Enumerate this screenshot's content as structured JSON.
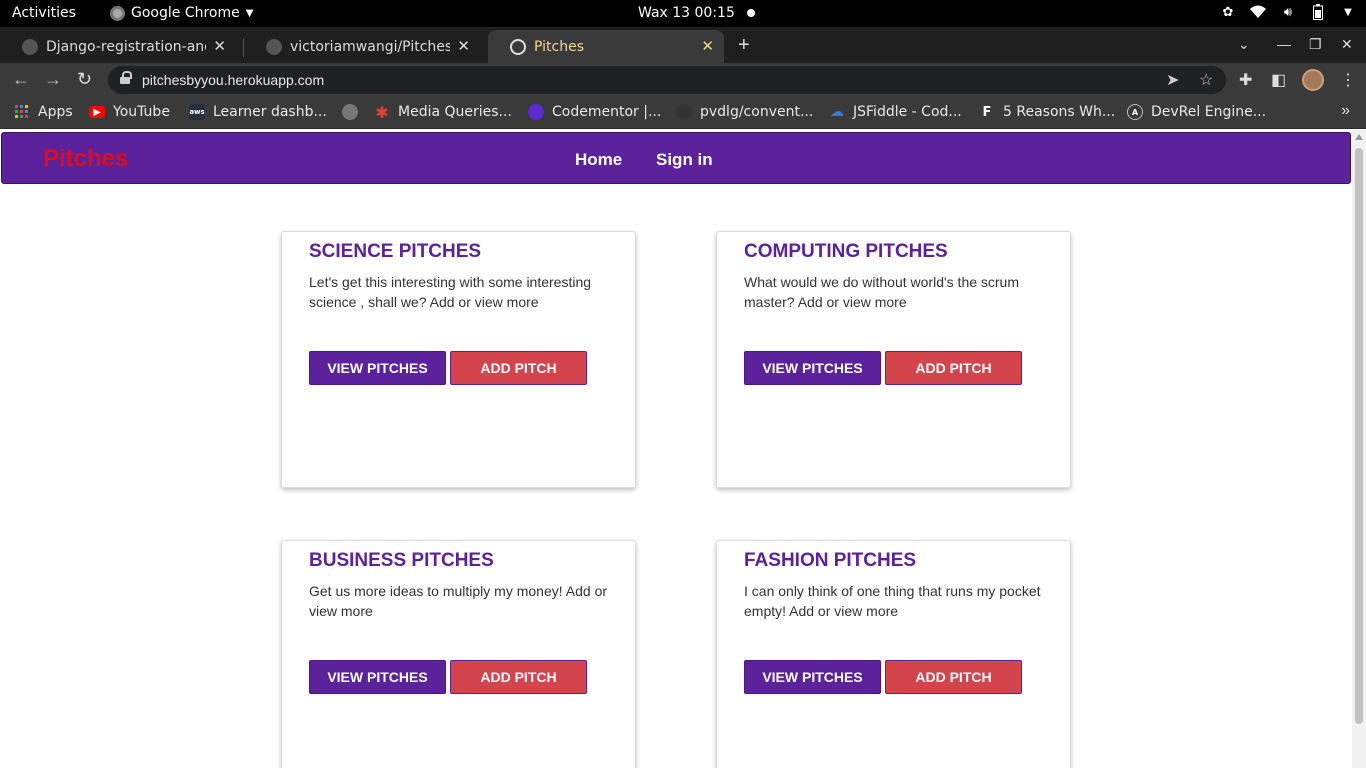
{
  "system_bar": {
    "activities": "Activities",
    "app_name": "Google Chrome",
    "clock": "Wax 13  00:15"
  },
  "tabs": [
    {
      "title": "Django-registration-and-l",
      "active": false
    },
    {
      "title": "victoriamwangi/Pitches: T",
      "active": false
    },
    {
      "title": "Pitches",
      "active": true
    }
  ],
  "address_bar": {
    "url": "pitchesbyyou.herokuapp.com"
  },
  "bookmarks": [
    {
      "label": "Apps",
      "icon": "apps-grid-icon",
      "color": "#e94235"
    },
    {
      "label": "YouTube",
      "icon": "youtube-icon",
      "color": "#ff0000"
    },
    {
      "label": "Learner dashb...",
      "icon": "aws-icon",
      "color": "#232f3e"
    },
    {
      "label": "",
      "icon": "globe-icon",
      "color": "#777777"
    },
    {
      "label": "Media Queries...",
      "icon": "asterisk-icon",
      "color": "#e94235"
    },
    {
      "label": "Codementor |...",
      "icon": "codementor-icon",
      "color": "#5a2bd1"
    },
    {
      "label": "pvdlg/convent...",
      "icon": "github-icon",
      "color": "#333333"
    },
    {
      "label": "JSFiddle - Cod...",
      "icon": "cloud-icon",
      "color": "#3c7ad9"
    },
    {
      "label": "5 Reasons Wh...",
      "icon": "f-icon",
      "color": "#222222"
    },
    {
      "label": "DevRel Engine...",
      "icon": "devrel-icon",
      "color": "#2c2c6e"
    }
  ],
  "site": {
    "brand": "Pitches",
    "nav": {
      "home": "Home",
      "sign_in": "Sign in"
    },
    "colors": {
      "primary": "#5b229b",
      "danger": "#d4444d",
      "brand": "#e00b1b"
    }
  },
  "cards": [
    {
      "title": "SCIENCE PITCHES",
      "text": "Let's get this interesting with some interesting science , shall we? Add or view more",
      "view_label": "VIEW PITCHES",
      "add_label": "ADD PITCH"
    },
    {
      "title": "COMPUTING PITCHES",
      "text": "What would we do without world's the scrum master? Add or view more",
      "view_label": "VIEW PITCHES",
      "add_label": "ADD PITCH"
    },
    {
      "title": "BUSINESS PITCHES",
      "text": "Get us more ideas to multiply my money! Add or view more",
      "view_label": "VIEW PITCHES",
      "add_label": "ADD PITCH"
    },
    {
      "title": "FASHION PITCHES",
      "text": "I can only think of one thing that runs my pocket empty! Add or view more",
      "view_label": "VIEW PITCHES",
      "add_label": "ADD PITCH"
    }
  ]
}
